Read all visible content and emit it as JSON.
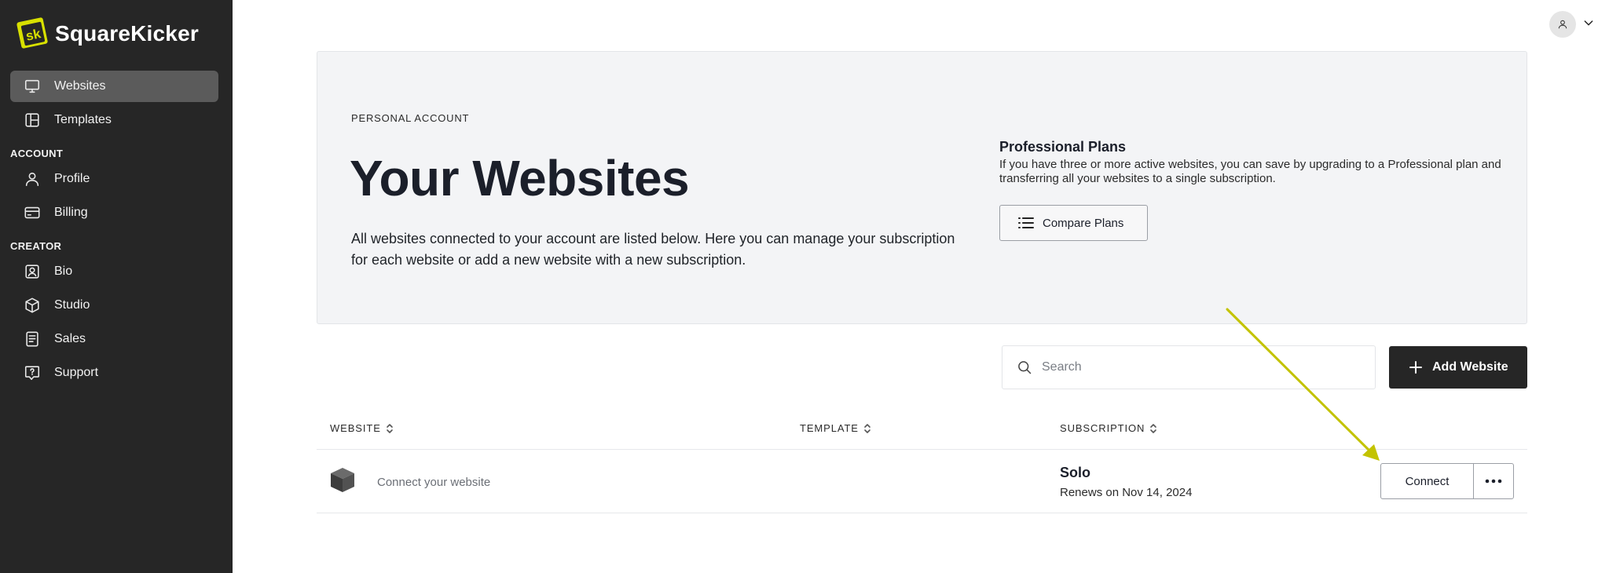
{
  "brand": {
    "name": "SquareKicker",
    "logo_text": "sk"
  },
  "sidebar": {
    "items": [
      {
        "label": "Websites",
        "icon": "monitor-icon",
        "active": true
      },
      {
        "label": "Templates",
        "icon": "layout-icon",
        "active": false
      }
    ],
    "sections": [
      {
        "title": "ACCOUNT",
        "items": [
          {
            "label": "Profile",
            "icon": "user-icon"
          },
          {
            "label": "Billing",
            "icon": "credit-card-icon"
          }
        ]
      },
      {
        "title": "CREATOR",
        "items": [
          {
            "label": "Bio",
            "icon": "id-badge-icon"
          },
          {
            "label": "Studio",
            "icon": "cube-icon"
          },
          {
            "label": "Sales",
            "icon": "receipt-icon"
          },
          {
            "label": "Support",
            "icon": "help-message-icon"
          }
        ]
      }
    ]
  },
  "topbar": {
    "avatar_icon": "user-avatar-icon",
    "menu_icon": "chevron-down-icon"
  },
  "hero": {
    "eyebrow": "PERSONAL ACCOUNT",
    "title": "Your Websites",
    "description": "All websites connected to your account are listed below. Here you can manage your subscription for each website or add a new website with a new subscription.",
    "plans_title": "Professional Plans",
    "plans_description": "If you have three or more active websites, you can save by upgrading to a Professional plan and transferring all your websites to a single subscription.",
    "compare_label": "Compare Plans"
  },
  "search": {
    "placeholder": "Search",
    "value": ""
  },
  "add_website_label": "Add Website",
  "table": {
    "columns": [
      "WEBSITE",
      "TEMPLATE",
      "SUBSCRIPTION"
    ],
    "rows": [
      {
        "website": "Connect your website",
        "template": "",
        "plan": "Solo",
        "renews": "Renews on Nov 14, 2024",
        "connect_label": "Connect"
      }
    ]
  },
  "colors": {
    "sidebar_bg": "#262626",
    "active_item_bg": "#5b5b5b",
    "hero_bg": "#f3f4f6",
    "brand_accent": "#d8e000",
    "arrow_annotation": "#c3c300",
    "primary_button": "#262626"
  }
}
